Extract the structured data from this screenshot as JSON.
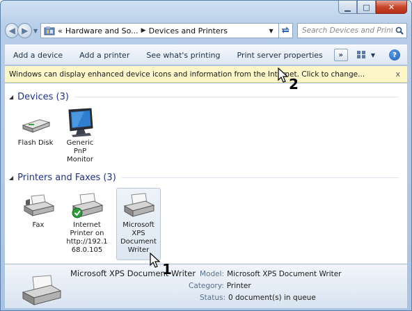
{
  "window": {
    "caption_buttons": [
      "minimize",
      "maximize",
      "close"
    ]
  },
  "address_bar": {
    "prefix": "«",
    "crumbs": [
      "Hardware and So...",
      "Devices and Printers"
    ],
    "search_placeholder": "Search Devices and Printers"
  },
  "commands": {
    "add_device": "Add a device",
    "add_printer": "Add a printer",
    "see_printing": "See what's printing",
    "print_server": "Print server properties",
    "more": "»"
  },
  "infobar": {
    "message": "Windows can display enhanced device icons and information from the Internet. Click to change...",
    "close": "x"
  },
  "groups": {
    "devices": {
      "title": "Devices (3)",
      "items": [
        {
          "label_lines": [
            "Flash Disk"
          ],
          "icon": "flash-disk-icon"
        },
        {
          "label_lines": [
            "Generic",
            "PnP",
            "Monitor"
          ],
          "icon": "monitor-icon"
        }
      ]
    },
    "printers": {
      "title": "Printers and Faxes (3)",
      "items": [
        {
          "label_lines": [
            "Fax"
          ],
          "icon": "fax-icon"
        },
        {
          "label_lines": [
            "Internet",
            "Printer on",
            "http://192.1",
            "68.0.105"
          ],
          "icon": "printer-default-icon"
        },
        {
          "label_lines": [
            "Microsoft",
            "XPS",
            "Document",
            "Writer"
          ],
          "icon": "printer-icon"
        }
      ]
    }
  },
  "details": {
    "name": "Microsoft XPS Document Writer",
    "model_key": "Model:",
    "model_val": "Microsoft XPS Document Writer",
    "category_key": "Category:",
    "category_val": "Printer",
    "status_key": "Status:",
    "status_val": "0 document(s) in queue"
  },
  "callouts": {
    "one": "1",
    "two": "2"
  },
  "colors": {
    "group_title": "#1e3287",
    "infobar_bg": "#fcf6c9",
    "close_button": "#c8452c"
  }
}
